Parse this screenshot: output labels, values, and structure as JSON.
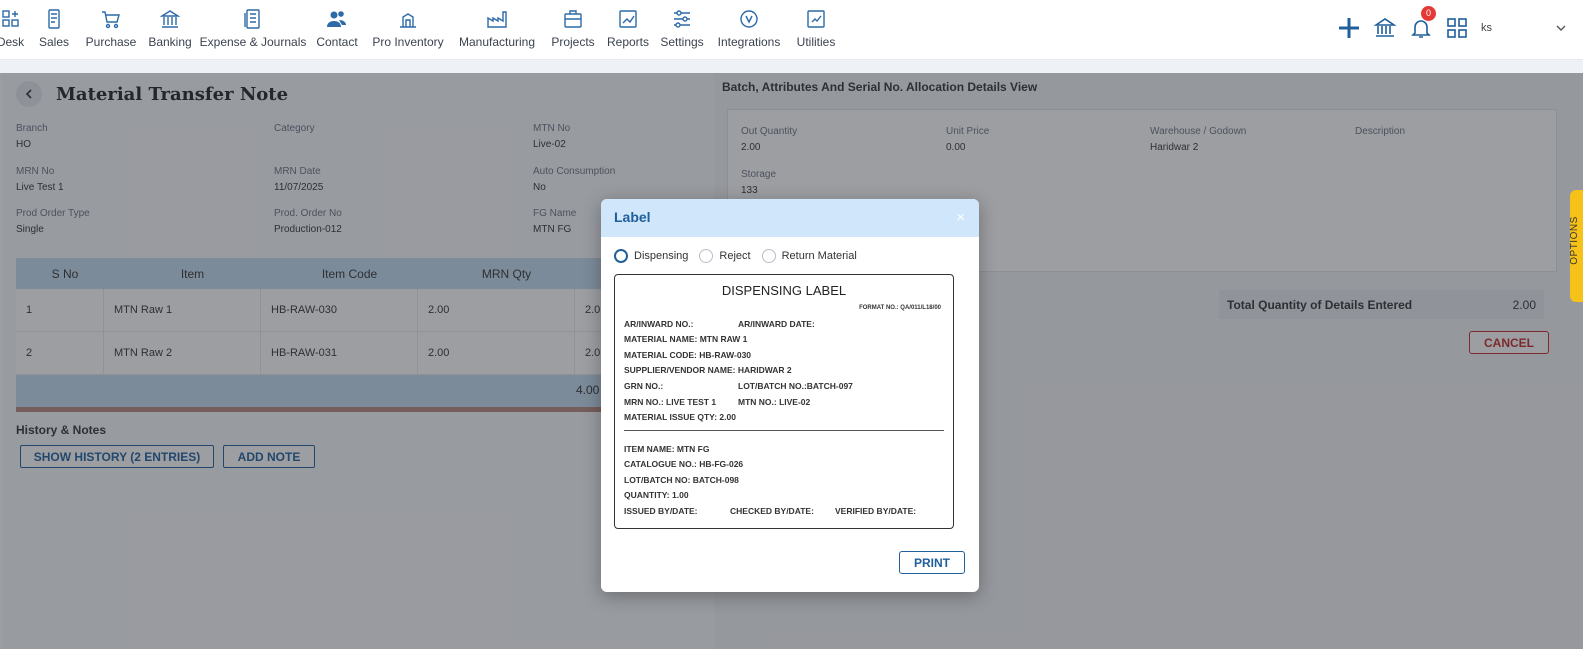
{
  "nav": {
    "items": [
      {
        "label": "Desk",
        "icon": "desk-icon"
      },
      {
        "label": "Sales",
        "icon": "sales-icon"
      },
      {
        "label": "Purchase",
        "icon": "cart-icon"
      },
      {
        "label": "Banking",
        "icon": "bank-icon"
      },
      {
        "label": "Expense & Journals",
        "icon": "journal-icon"
      },
      {
        "label": "Contact",
        "icon": "contact-icon"
      },
      {
        "label": "Pro Inventory",
        "icon": "inventory-icon"
      },
      {
        "label": "Manufacturing",
        "icon": "factory-icon"
      },
      {
        "label": "Projects",
        "icon": "projects-icon"
      },
      {
        "label": "Reports",
        "icon": "reports-icon"
      },
      {
        "label": "Settings",
        "icon": "settings-icon"
      },
      {
        "label": "Integrations",
        "icon": "integrations-icon"
      },
      {
        "label": "Utilities",
        "icon": "utilities-icon"
      }
    ],
    "notifications_count": "0",
    "user": "ks"
  },
  "page": {
    "title": "Material Transfer Note",
    "fields": [
      {
        "label": "Branch",
        "value": "HO"
      },
      {
        "label": "Category",
        "value": ""
      },
      {
        "label": "MTN No",
        "value": "Live-02"
      },
      {
        "label": "MRN No",
        "value": "Live Test 1"
      },
      {
        "label": "MRN Date",
        "value": "11/07/2025"
      },
      {
        "label": "Auto Consumption",
        "value": "No"
      },
      {
        "label": "Prod Order Type",
        "value": "Single"
      },
      {
        "label": "Prod. Order No",
        "value": "Production-012"
      },
      {
        "label": "FG Name",
        "value": "MTN FG"
      }
    ]
  },
  "table": {
    "headers": [
      "S No",
      "Item",
      "Item Code",
      "MRN Qty"
    ],
    "rows": [
      [
        "1",
        "MTN Raw 1",
        "HB-RAW-030",
        "2.00",
        "2.0"
      ],
      [
        "2",
        "MTN Raw 2",
        "HB-RAW-031",
        "2.00",
        "2.0"
      ]
    ],
    "footer_total": "4.00"
  },
  "history": {
    "title": "History & Notes",
    "show_history_label": "SHOW HISTORY (2 ENTRIES)",
    "add_note_label": "ADD NOTE"
  },
  "allocation": {
    "title": "Batch, Attributes And Serial No. Allocation Details View",
    "fields": [
      {
        "label": "Out Quantity",
        "value": "2.00"
      },
      {
        "label": "Unit Price",
        "value": "0.00"
      },
      {
        "label": "Warehouse / Godown",
        "value": "Haridwar 2"
      },
      {
        "label": "Description",
        "value": ""
      },
      {
        "label": "Storage",
        "value": "133"
      }
    ],
    "total_label": "Total Quantity of Details Entered",
    "total_value": "2.00",
    "cancel_label": "CANCEL"
  },
  "options_tab": "OPTIONS",
  "modal": {
    "title": "Label",
    "close": "×",
    "radios": [
      {
        "label": "Dispensing",
        "selected": true
      },
      {
        "label": "Reject",
        "selected": false
      },
      {
        "label": "Return Material",
        "selected": false
      }
    ],
    "label_card": {
      "heading": "DISPENSING LABEL",
      "format_no": "FORMAT NO.: QA/011/L18/00",
      "ar_no": "AR/INWARD NO.:",
      "ar_date": "AR/INWARD DATE:",
      "material_name": "MATERIAL NAME: MTN RAW 1",
      "material_code": "MATERIAL CODE: HB-RAW-030",
      "supplier": "SUPPLIER/VENDOR NAME: HARIDWAR 2",
      "grn_no": "GRN NO.:",
      "lot_batch": "LOT/BATCH NO.:BATCH-097",
      "mrn_no": "MRN NO.: LIVE TEST 1",
      "mtn_no": "MTN NO.: LIVE-02",
      "issue_qty": "MATERIAL ISSUE QTY: 2.00",
      "item_name": "ITEM NAME: MTN FG",
      "catalogue_no": "CATALOGUE NO.: HB-FG-026",
      "fg_lot_batch": "LOT/BATCH NO: BATCH-098",
      "quantity": "QUANTITY: 1.00",
      "issued_by": "ISSUED BY/DATE:",
      "checked_by": "CHECKED BY/DATE:",
      "verified_by": "VERIFIED BY/DATE:"
    },
    "print_label": "PRINT"
  },
  "colors": {
    "brand": "#1f5f9c",
    "header_blue": "#c5dcef",
    "modal_header": "#cfe6fb",
    "cancel_red": "#c62828",
    "options_yellow": "#f6c21a",
    "badge_red": "#e53935"
  }
}
